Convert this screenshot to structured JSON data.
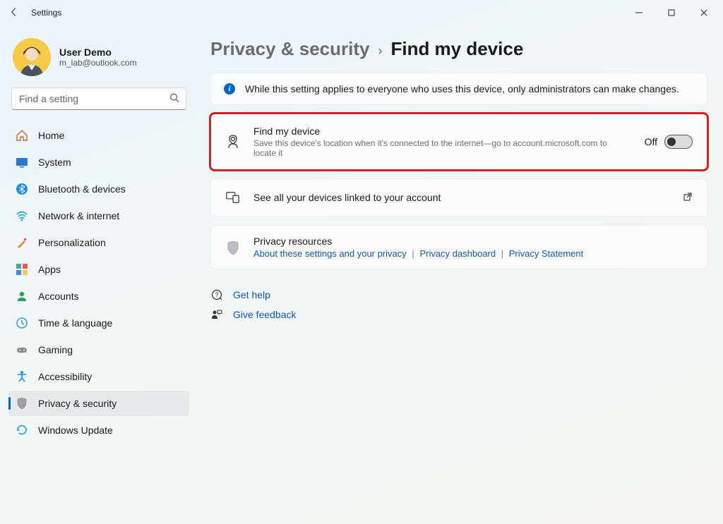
{
  "window": {
    "title": "Settings"
  },
  "user": {
    "name": "User Demo",
    "email": "m_lab@outlook.com"
  },
  "search": {
    "placeholder": "Find a setting"
  },
  "sidebar": {
    "items": [
      {
        "label": "Home",
        "icon": "home-icon"
      },
      {
        "label": "System",
        "icon": "system-icon"
      },
      {
        "label": "Bluetooth & devices",
        "icon": "bluetooth-icon"
      },
      {
        "label": "Network & internet",
        "icon": "network-icon"
      },
      {
        "label": "Personalization",
        "icon": "personalization-icon"
      },
      {
        "label": "Apps",
        "icon": "apps-icon"
      },
      {
        "label": "Accounts",
        "icon": "accounts-icon"
      },
      {
        "label": "Time & language",
        "icon": "time-language-icon"
      },
      {
        "label": "Gaming",
        "icon": "gaming-icon"
      },
      {
        "label": "Accessibility",
        "icon": "accessibility-icon"
      },
      {
        "label": "Privacy & security",
        "icon": "privacy-icon",
        "active": true
      },
      {
        "label": "Windows Update",
        "icon": "update-icon"
      }
    ]
  },
  "breadcrumb": {
    "parent": "Privacy & security",
    "current": "Find my device"
  },
  "info_banner": {
    "text": "While this setting applies to everyone who uses this device, only administrators can make changes."
  },
  "find_my_device": {
    "title": "Find my device",
    "subtitle": "Save this device's location when it's connected to the internet—go to account.microsoft.com to locate it",
    "toggle_state_label": "Off",
    "toggle_on": false
  },
  "devices_link": {
    "label": "See all your devices linked to your account"
  },
  "privacy_resources": {
    "title": "Privacy resources",
    "link1": "About these settings and your privacy",
    "link2": "Privacy dashboard",
    "link3": "Privacy Statement"
  },
  "footer": {
    "help": "Get help",
    "feedback": "Give feedback"
  }
}
